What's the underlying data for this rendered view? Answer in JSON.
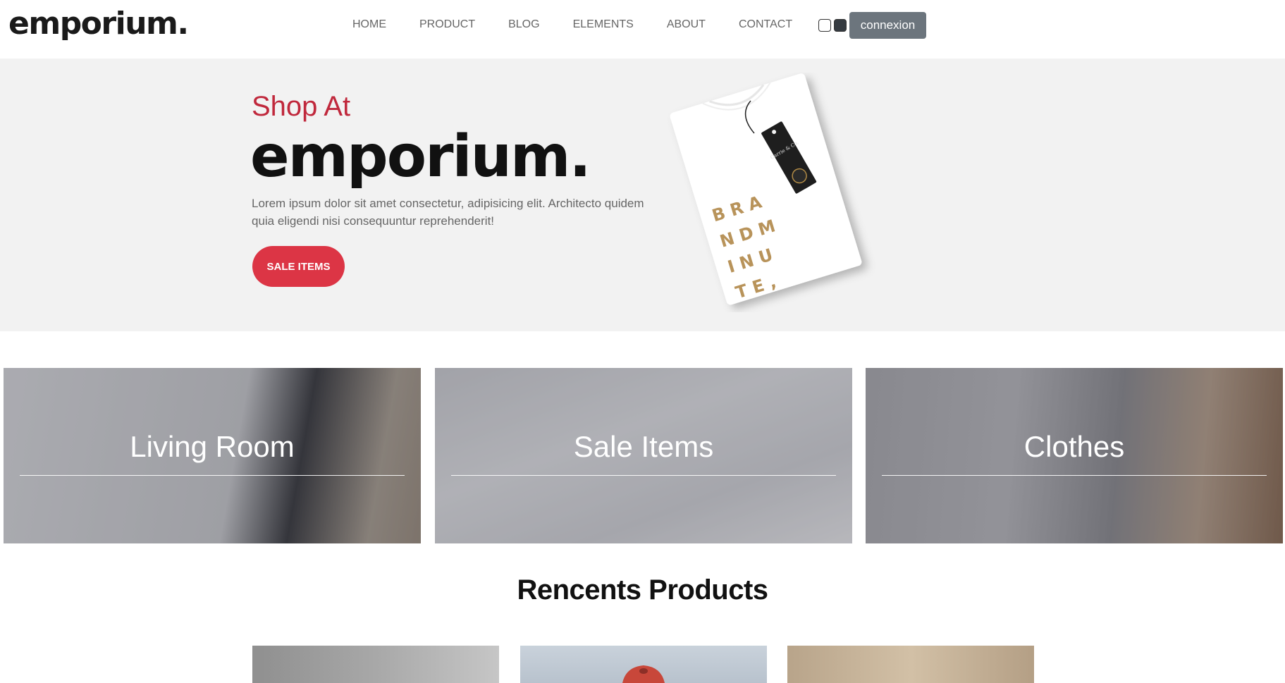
{
  "header": {
    "logo": "emporium.",
    "nav": [
      "HOME",
      "PRODUCT",
      "BLOG",
      "ELEMENTS",
      "ABOUT",
      "CONTACT"
    ],
    "connexion_label": "connexion"
  },
  "hero": {
    "kicker": "Shop At",
    "title": "emporium.",
    "text": "Lorem ipsum dolor sit amet consectetur, adipisicing elit. Architecto quidem quia eligendi nisi consequuntur reprehenderit!",
    "button_label": "SALE ITEMS",
    "tag_text": "Carrie & Co.",
    "shirt_print": [
      "B R A",
      "N D   M",
      "I   N U",
      "T   E ,"
    ]
  },
  "categories": [
    {
      "label": "Living Room"
    },
    {
      "label": "Sale Items"
    },
    {
      "label": "Clothes"
    }
  ],
  "recent": {
    "title": "Rencents Products"
  },
  "colors": {
    "accent": "#dc3545",
    "kicker": "#c0283c",
    "button_secondary": "#6c757d",
    "hero_bg": "#f2f2f2"
  }
}
